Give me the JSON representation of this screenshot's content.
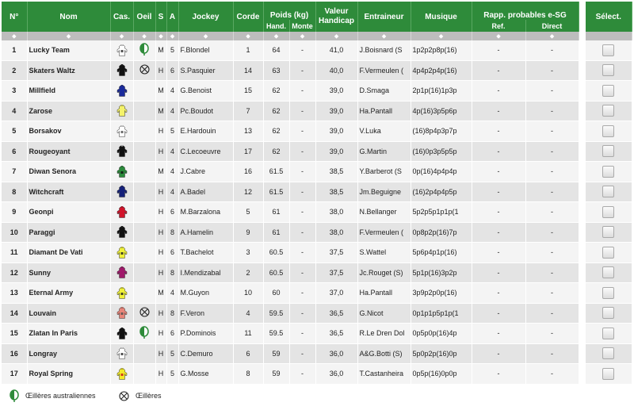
{
  "headers": {
    "num": "N°",
    "nom": "Nom",
    "casaque": "Cas.",
    "oeil": "Oeil",
    "sexe": "S",
    "age": "A",
    "jockey": "Jockey",
    "corde": "Corde",
    "poids": "Poids (kg)",
    "poids_hand": "Hand.",
    "poids_monte": "Monte",
    "valeur": "Valeur Handicap",
    "entraineur": "Entraineur",
    "musique": "Musique",
    "rapp": "Rapp. probables e-SG",
    "rapp_ref": "Ref.",
    "rapp_direct": "Direct",
    "select": "Sélect."
  },
  "sort_arrow": "⬥",
  "rows": [
    {
      "num": "1",
      "nom": "Lucky Team",
      "oeil": "australiennes",
      "sexe": "M",
      "age": "5",
      "jockey": "F.Blondel",
      "corde": "1",
      "hand": "64",
      "monte": "-",
      "valeur": "41,0",
      "entraineur": "J.Boisnard (S",
      "musique": "1p2p2p8p(16)",
      "ref": "-",
      "direct": "-",
      "silk": {
        "body": "#ffffff",
        "sleeve": "#ffffff",
        "pattern": "#333333"
      }
    },
    {
      "num": "2",
      "nom": "Skaters Waltz",
      "oeil": "oeilleres",
      "sexe": "H",
      "age": "6",
      "jockey": "S.Pasquier",
      "corde": "14",
      "hand": "63",
      "monte": "-",
      "valeur": "40,0",
      "entraineur": "F.Vermeulen (",
      "musique": "4p4p2p4p(16)",
      "ref": "-",
      "direct": "-",
      "silk": {
        "body": "#111111",
        "sleeve": "#111111",
        "pattern": "#111111"
      }
    },
    {
      "num": "3",
      "nom": "Millfield",
      "oeil": "",
      "sexe": "M",
      "age": "4",
      "jockey": "G.Benoist",
      "corde": "15",
      "hand": "62",
      "monte": "-",
      "valeur": "39,0",
      "entraineur": "D.Smaga",
      "musique": "2p1p(16)1p3p",
      "ref": "-",
      "direct": "-",
      "silk": {
        "body": "#1a2a9c",
        "sleeve": "#1a2a9c",
        "pattern": "#1a2a9c"
      }
    },
    {
      "num": "4",
      "nom": "Zarose",
      "oeil": "",
      "sexe": "M",
      "age": "4",
      "jockey": "Pc.Boudot",
      "corde": "7",
      "hand": "62",
      "monte": "-",
      "valeur": "39,0",
      "entraineur": "Ha.Pantall",
      "musique": "4p(16)3p5p6p",
      "ref": "-",
      "direct": "-",
      "silk": {
        "body": "#f4f26a",
        "sleeve": "#f4f26a",
        "pattern": "#f4f26a"
      }
    },
    {
      "num": "5",
      "nom": "Borsakov",
      "oeil": "",
      "sexe": "H",
      "age": "5",
      "jockey": "E.Hardouin",
      "corde": "13",
      "hand": "62",
      "monte": "-",
      "valeur": "39,0",
      "entraineur": "V.Luka",
      "musique": "(16)8p4p3p7p",
      "ref": "-",
      "direct": "-",
      "silk": {
        "body": "#ffffff",
        "sleeve": "#ffffff",
        "pattern": "#555555"
      }
    },
    {
      "num": "6",
      "nom": "Rougeoyant",
      "oeil": "",
      "sexe": "H",
      "age": "4",
      "jockey": "C.Lecoeuvre",
      "corde": "17",
      "hand": "62",
      "monte": "-",
      "valeur": "39,0",
      "entraineur": "G.Martin",
      "musique": "(16)0p3p5p5p",
      "ref": "-",
      "direct": "-",
      "silk": {
        "body": "#111111",
        "sleeve": "#d9d9d9",
        "pattern": "#111111"
      }
    },
    {
      "num": "7",
      "nom": "Diwan Senora",
      "oeil": "",
      "sexe": "M",
      "age": "4",
      "jockey": "J.Cabre",
      "corde": "16",
      "hand": "61.5",
      "monte": "-",
      "valeur": "38,5",
      "entraineur": "Y.Barberot (S",
      "musique": "0p(16)4p4p4p",
      "ref": "-",
      "direct": "-",
      "silk": {
        "body": "#2a8a3a",
        "sleeve": "#2a8a3a",
        "pattern": "#111111"
      }
    },
    {
      "num": "8",
      "nom": "Witchcraft",
      "oeil": "",
      "sexe": "H",
      "age": "4",
      "jockey": "A.Badel",
      "corde": "12",
      "hand": "61.5",
      "monte": "-",
      "valeur": "38,5",
      "entraineur": "Jm.Beguigne",
      "musique": "(16)2p4p4p5p",
      "ref": "-",
      "direct": "-",
      "silk": {
        "body": "#14207a",
        "sleeve": "#14207a",
        "pattern": "#14207a"
      }
    },
    {
      "num": "9",
      "nom": "Geonpi",
      "oeil": "",
      "sexe": "H",
      "age": "6",
      "jockey": "M.Barzalona",
      "corde": "5",
      "hand": "61",
      "monte": "-",
      "valeur": "38,0",
      "entraineur": "N.Bellanger",
      "musique": "5p2p5p1p1p(1",
      "ref": "-",
      "direct": "-",
      "silk": {
        "body": "#d1132a",
        "sleeve": "#d1132a",
        "pattern": "#d1132a"
      }
    },
    {
      "num": "10",
      "nom": "Paraggi",
      "oeil": "",
      "sexe": "H",
      "age": "8",
      "jockey": "A.Hamelin",
      "corde": "9",
      "hand": "61",
      "monte": "-",
      "valeur": "38,0",
      "entraineur": "F.Vermeulen (",
      "musique": "0p8p2p(16)7p",
      "ref": "-",
      "direct": "-",
      "silk": {
        "body": "#111111",
        "sleeve": "#111111",
        "pattern": "#111111"
      }
    },
    {
      "num": "11",
      "nom": "Diamant De Vati",
      "oeil": "",
      "sexe": "H",
      "age": "6",
      "jockey": "T.Bachelot",
      "corde": "3",
      "hand": "60.5",
      "monte": "-",
      "valeur": "37,5",
      "entraineur": "S.Wattel",
      "musique": "5p6p4p1p(16)",
      "ref": "-",
      "direct": "-",
      "silk": {
        "body": "#eef03a",
        "sleeve": "#eef03a",
        "pattern": "#222222"
      }
    },
    {
      "num": "12",
      "nom": "Sunny",
      "oeil": "",
      "sexe": "H",
      "age": "8",
      "jockey": "I.Mendizabal",
      "corde": "2",
      "hand": "60.5",
      "monte": "-",
      "valeur": "37,5",
      "entraineur": "Jc.Rouget (S)",
      "musique": "5p1p(16)3p2p",
      "ref": "-",
      "direct": "-",
      "silk": {
        "body": "#a0186a",
        "sleeve": "#a0186a",
        "pattern": "#a0186a"
      }
    },
    {
      "num": "13",
      "nom": "Eternal Army",
      "oeil": "",
      "sexe": "M",
      "age": "4",
      "jockey": "M.Guyon",
      "corde": "10",
      "hand": "60",
      "monte": "-",
      "valeur": "37,0",
      "entraineur": "Ha.Pantall",
      "musique": "3p9p2p0p(16)",
      "ref": "-",
      "direct": "-",
      "silk": {
        "body": "#eef03a",
        "sleeve": "#eef03a",
        "pattern": "#222222"
      }
    },
    {
      "num": "14",
      "nom": "Louvain",
      "oeil": "oeilleres",
      "sexe": "H",
      "age": "8",
      "jockey": "F.Veron",
      "corde": "4",
      "hand": "59.5",
      "monte": "-",
      "valeur": "36,5",
      "entraineur": "G.Nicot",
      "musique": "0p1p1p5p1p(1",
      "ref": "-",
      "direct": "-",
      "silk": {
        "body": "#e8857a",
        "sleeve": "#e8857a",
        "pattern": "#555555"
      }
    },
    {
      "num": "15",
      "nom": "Zlatan In Paris",
      "oeil": "australiennes",
      "sexe": "H",
      "age": "6",
      "jockey": "P.Dominois",
      "corde": "11",
      "hand": "59.5",
      "monte": "-",
      "valeur": "36,5",
      "entraineur": "R.Le Dren Dol",
      "musique": "0p5p0p(16)4p",
      "ref": "-",
      "direct": "-",
      "silk": {
        "body": "#111111",
        "sleeve": "#111111",
        "pattern": "#111111"
      }
    },
    {
      "num": "16",
      "nom": "Longray",
      "oeil": "",
      "sexe": "H",
      "age": "5",
      "jockey": "C.Demuro",
      "corde": "6",
      "hand": "59",
      "monte": "-",
      "valeur": "36,0",
      "entraineur": "A&G.Botti (S)",
      "musique": "5p0p2p(16)0p",
      "ref": "-",
      "direct": "-",
      "silk": {
        "body": "#ffffff",
        "sleeve": "#ffffff",
        "pattern": "#333333"
      }
    },
    {
      "num": "17",
      "nom": "Royal Spring",
      "oeil": "",
      "sexe": "H",
      "age": "5",
      "jockey": "G.Mosse",
      "corde": "8",
      "hand": "59",
      "monte": "-",
      "valeur": "36,0",
      "entraineur": "T.Castanheira",
      "musique": "0p5p(16)0p0p",
      "ref": "-",
      "direct": "-",
      "silk": {
        "body": "#f2ea2a",
        "sleeve": "#f2ea2a",
        "pattern": "#cc1a1a"
      }
    }
  ],
  "legend": {
    "australiennes": "Œillères australiennes",
    "oeilleres": "Œillères"
  },
  "colors": {
    "header_green": "#2e8b3a",
    "sort_gray": "#bdbdbd",
    "row_odd": "#f4f4f4",
    "row_even": "#e4e4e4"
  }
}
